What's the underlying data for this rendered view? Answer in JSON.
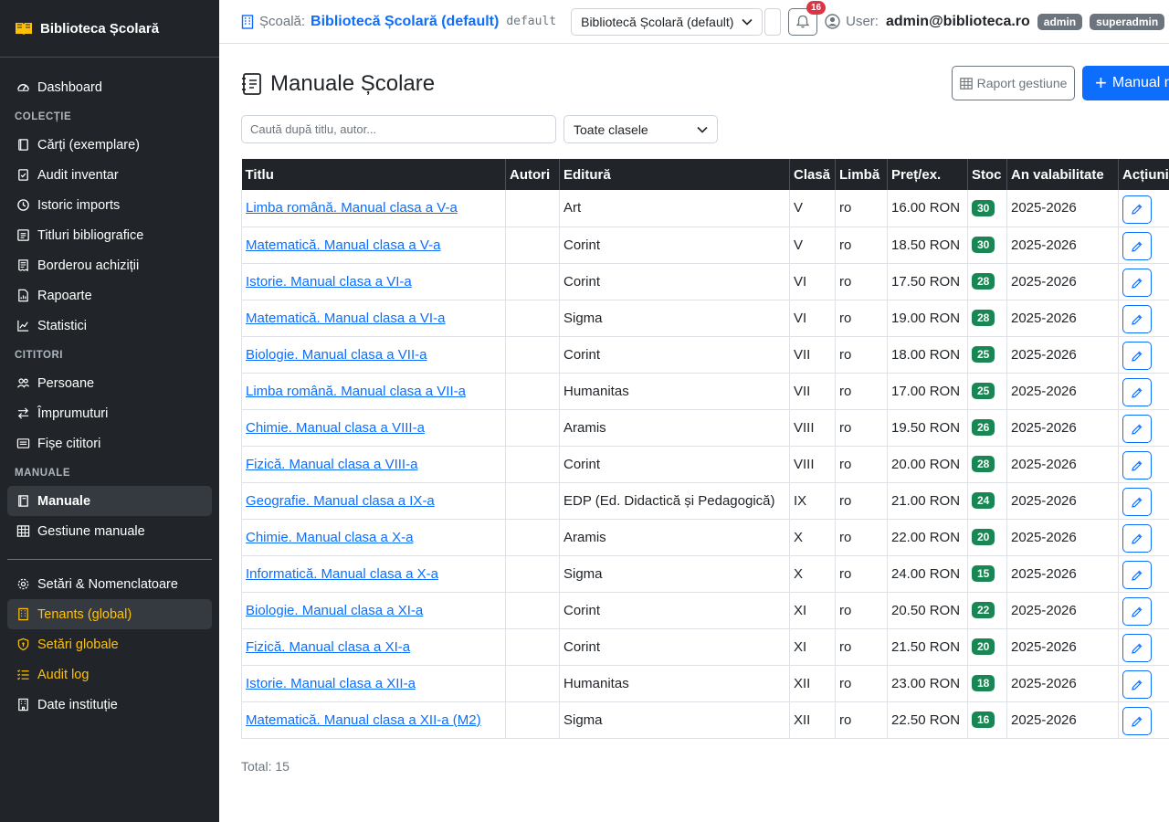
{
  "brand": {
    "name": "Biblioteca Școlară"
  },
  "sidebar": {
    "top_items": [
      {
        "label": "Dashboard",
        "icon": "dashboard-icon"
      }
    ],
    "sections": {
      "colectie": "COLECȚIE",
      "cititori": "CITITORI",
      "manuale": "MANUALE"
    },
    "colectie_items": [
      {
        "label": "Cărți (exemplare)",
        "icon": "book-icon"
      },
      {
        "label": "Audit inventar",
        "icon": "clipboard-check-icon"
      },
      {
        "label": "Istoric imports",
        "icon": "clock-icon"
      },
      {
        "label": "Titluri bibliografice",
        "icon": "list-icon"
      },
      {
        "label": "Borderou achiziții",
        "icon": "receipt-icon"
      },
      {
        "label": "Rapoarte",
        "icon": "report-icon"
      },
      {
        "label": "Statistici",
        "icon": "chart-icon"
      }
    ],
    "cititori_items": [
      {
        "label": "Persoane",
        "icon": "people-icon"
      },
      {
        "label": "Împrumuturi",
        "icon": "swap-icon"
      },
      {
        "label": "Fișe cititori",
        "icon": "card-icon"
      }
    ],
    "manuale_items": [
      {
        "label": "Manuale",
        "icon": "textbook-icon"
      },
      {
        "label": "Gestiune manuale",
        "icon": "grid-icon"
      }
    ],
    "bottom_items": [
      {
        "label": "Setări & Nomenclatoare",
        "icon": "gear-icon"
      },
      {
        "label": "Tenants (global)",
        "icon": "building-icon"
      },
      {
        "label": "Setări globale",
        "icon": "shield-icon"
      },
      {
        "label": "Audit log",
        "icon": "list-check-icon"
      },
      {
        "label": "Date instituție",
        "icon": "institution-icon"
      }
    ]
  },
  "topbar": {
    "school_label": "Școală:",
    "school_name": "Bibliotecă Școlară (default)",
    "school_code": "default",
    "school_select": "Bibliotecă Școlară (default)",
    "notif_count": "16",
    "user_label": "User:",
    "user_email": "admin@biblioteca.ro",
    "roles": [
      "admin",
      "superadmin"
    ]
  },
  "page": {
    "title": "Manuale Școlare",
    "report_button": "Raport gestiune",
    "add_button": "Manual nou",
    "search_placeholder": "Caută după titlu, autor...",
    "class_filter": "Toate clasele",
    "total": "Total: 15"
  },
  "table": {
    "headers": [
      "Titlu",
      "Autori",
      "Editură",
      "Clasă",
      "Limbă",
      "Preț/ex.",
      "Stoc",
      "An valabilitate",
      "Acțiuni"
    ],
    "rows": [
      {
        "title": "Limba română. Manual clasa a V-a",
        "authors": "",
        "publisher": "Art",
        "class": "V",
        "lang": "ro",
        "price": "16.00 RON",
        "stock": "30",
        "year": "2025-2026"
      },
      {
        "title": "Matematică. Manual clasa a V-a",
        "authors": "",
        "publisher": "Corint",
        "class": "V",
        "lang": "ro",
        "price": "18.50 RON",
        "stock": "30",
        "year": "2025-2026"
      },
      {
        "title": "Istorie. Manual clasa a VI-a",
        "authors": "",
        "publisher": "Corint",
        "class": "VI",
        "lang": "ro",
        "price": "17.50 RON",
        "stock": "28",
        "year": "2025-2026"
      },
      {
        "title": "Matematică. Manual clasa a VI-a",
        "authors": "",
        "publisher": "Sigma",
        "class": "VI",
        "lang": "ro",
        "price": "19.00 RON",
        "stock": "28",
        "year": "2025-2026"
      },
      {
        "title": "Biologie. Manual clasa a VII-a",
        "authors": "",
        "publisher": "Corint",
        "class": "VII",
        "lang": "ro",
        "price": "18.00 RON",
        "stock": "25",
        "year": "2025-2026"
      },
      {
        "title": "Limba română. Manual clasa a VII-a",
        "authors": "",
        "publisher": "Humanitas",
        "class": "VII",
        "lang": "ro",
        "price": "17.00 RON",
        "stock": "25",
        "year": "2025-2026"
      },
      {
        "title": "Chimie. Manual clasa a VIII-a",
        "authors": "",
        "publisher": "Aramis",
        "class": "VIII",
        "lang": "ro",
        "price": "19.50 RON",
        "stock": "26",
        "year": "2025-2026"
      },
      {
        "title": "Fizică. Manual clasa a VIII-a",
        "authors": "",
        "publisher": "Corint",
        "class": "VIII",
        "lang": "ro",
        "price": "20.00 RON",
        "stock": "28",
        "year": "2025-2026"
      },
      {
        "title": "Geografie. Manual clasa a IX-a",
        "authors": "",
        "publisher": "EDP (Ed. Didactică și Pedagogică)",
        "class": "IX",
        "lang": "ro",
        "price": "21.00 RON",
        "stock": "24",
        "year": "2025-2026"
      },
      {
        "title": "Chimie. Manual clasa a X-a",
        "authors": "",
        "publisher": "Aramis",
        "class": "X",
        "lang": "ro",
        "price": "22.00 RON",
        "stock": "20",
        "year": "2025-2026"
      },
      {
        "title": "Informatică. Manual clasa a X-a",
        "authors": "",
        "publisher": "Sigma",
        "class": "X",
        "lang": "ro",
        "price": "24.00 RON",
        "stock": "15",
        "year": "2025-2026"
      },
      {
        "title": "Biologie. Manual clasa a XI-a",
        "authors": "",
        "publisher": "Corint",
        "class": "XI",
        "lang": "ro",
        "price": "20.50 RON",
        "stock": "22",
        "year": "2025-2026"
      },
      {
        "title": "Fizică. Manual clasa a XI-a",
        "authors": "",
        "publisher": "Corint",
        "class": "XI",
        "lang": "ro",
        "price": "21.50 RON",
        "stock": "20",
        "year": "2025-2026"
      },
      {
        "title": "Istorie. Manual clasa a XII-a",
        "authors": "",
        "publisher": "Humanitas",
        "class": "XII",
        "lang": "ro",
        "price": "23.00 RON",
        "stock": "18",
        "year": "2025-2026"
      },
      {
        "title": "Matematică. Manual clasa a XII-a (M2)",
        "authors": "",
        "publisher": "Sigma",
        "class": "XII",
        "lang": "ro",
        "price": "22.50 RON",
        "stock": "16",
        "year": "2025-2026"
      }
    ]
  },
  "colors": {
    "sidebar_bg": "#212529",
    "accent": "#0d6efd",
    "stock_badge": "#198754",
    "global_admin": "#ffc107",
    "notif_badge": "#dc3545"
  }
}
